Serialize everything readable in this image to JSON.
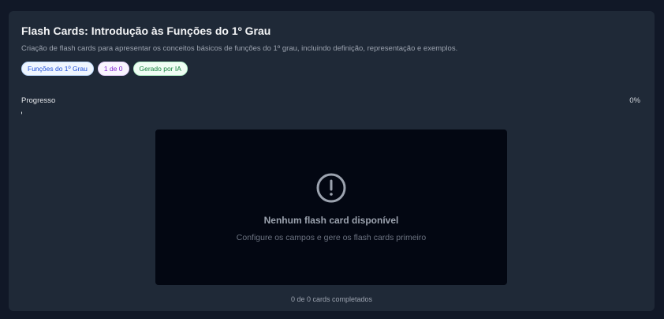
{
  "header": {
    "title": "Flash Cards: Introdução às Funções do 1º Grau",
    "description": "Criação de flash cards para apresentar os conceitos básicos de funções do 1º grau, incluindo definição, representação e exemplos."
  },
  "badges": [
    {
      "label": "Funções do 1º Grau",
      "color": "#1d4ed8"
    },
    {
      "label": "1 de 0",
      "color": "#7e22ce"
    },
    {
      "label": "Gerado por IA",
      "color": "#15803d"
    }
  ],
  "progress": {
    "label": "Progresso",
    "value_text": "0%",
    "fraction": 0
  },
  "empty_state": {
    "icon": "alert-circle-icon",
    "title": "Nenhum flash card disponível",
    "subtitle": "Configure os campos e gere os flash cards primeiro"
  },
  "footer": {
    "completed_text": "0 de 0 cards completados"
  },
  "colors": {
    "background": "#111827",
    "panel": "#1f2937",
    "card": "#030712"
  }
}
